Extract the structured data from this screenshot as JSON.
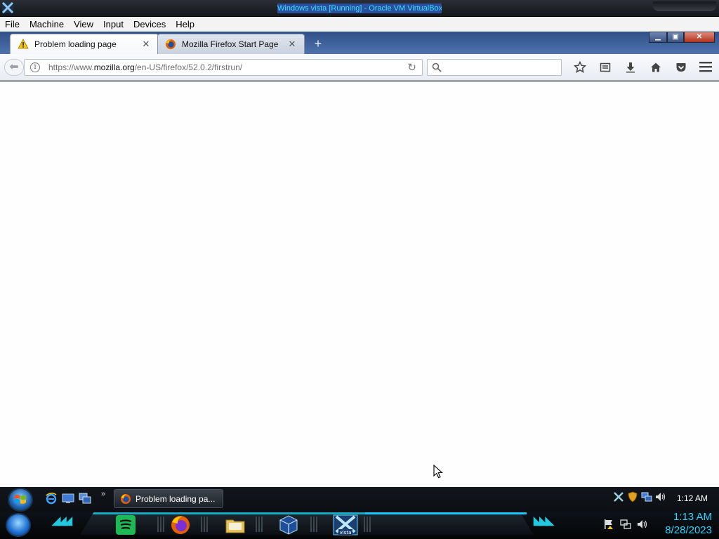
{
  "vbox": {
    "title": "Windows vista [Running] - Oracle VM VirtualBox",
    "menu": [
      "File",
      "Machine",
      "View",
      "Input",
      "Devices",
      "Help"
    ]
  },
  "firefox": {
    "tabs": [
      {
        "label": "Problem loading page",
        "icon": "warning-icon",
        "active": true
      },
      {
        "label": "Mozilla Firefox Start Page",
        "icon": "firefox-icon",
        "active": false
      }
    ],
    "url": {
      "prefix": "https://www.",
      "host": "mozilla.org",
      "path": "/en-US/firefox/52.0.2/firstrun/"
    },
    "search": {
      "placeholder": ""
    },
    "toolbar_icons": [
      "bookmark-star-icon",
      "reading-list-icon",
      "download-icon",
      "home-icon",
      "pocket-icon",
      "hamburger-menu-icon"
    ]
  },
  "taskbar": {
    "task_button_label": "Problem loading pa...",
    "clock_top": "1:12 AM",
    "clock_bottom_time": "1:13 AM",
    "clock_bottom_date": "8/28/2023",
    "quicklaunch": [
      "internet-explorer-icon",
      "show-desktop-icon",
      "switch-windows-icon"
    ],
    "dock": [
      "spotify-icon",
      "firefox-icon",
      "explorer-folder-icon",
      "virtualbox-icon",
      "virtualbox-vista-icon"
    ]
  },
  "colors": {
    "vbox_title_fg": "#38e0ff",
    "vbox_title_bg": "#2a4fa0",
    "tabstrip": "#3f5f99",
    "accent_cyan": "#1ec6ff",
    "spotify_green": "#1db954"
  }
}
